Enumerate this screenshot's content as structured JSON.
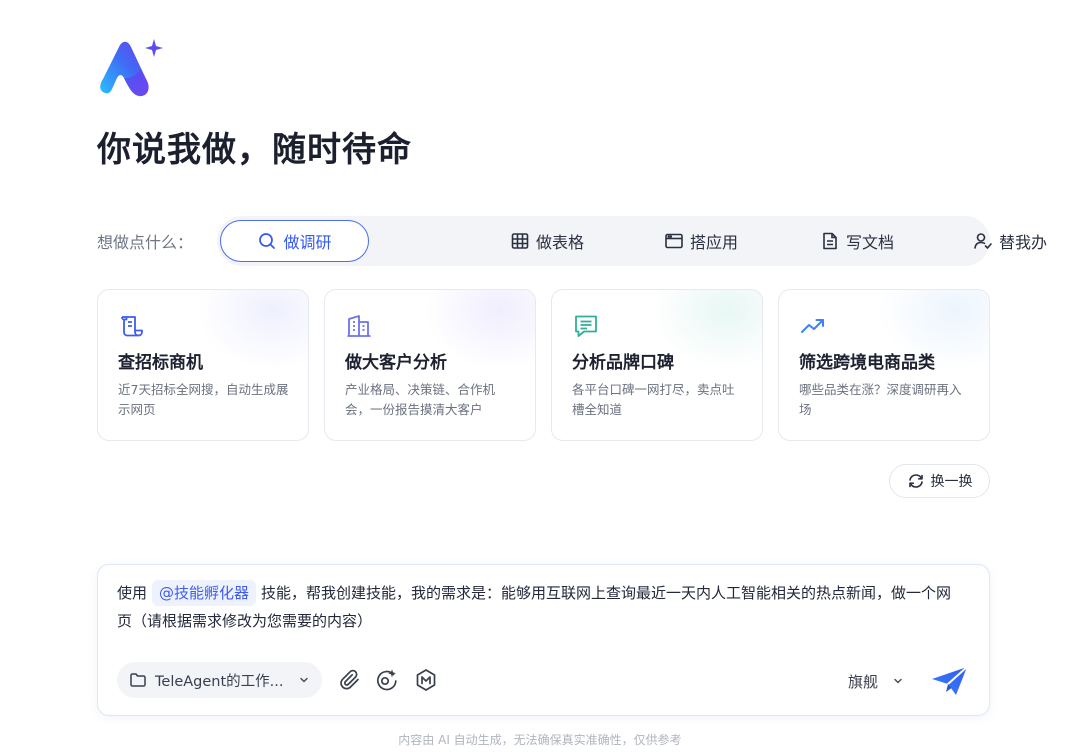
{
  "headline": "你说我做，随时待命",
  "prompt": {
    "label": "想做点什么：",
    "tabs": [
      {
        "label": "做调研",
        "icon": "search-icon",
        "active": true
      },
      {
        "label": "做表格",
        "icon": "table-icon",
        "active": false
      },
      {
        "label": "搭应用",
        "icon": "app-window-icon",
        "active": false
      },
      {
        "label": "写文档",
        "icon": "document-icon",
        "active": false
      },
      {
        "label": "替我办",
        "icon": "user-check-icon",
        "active": false
      }
    ]
  },
  "cards": [
    {
      "title": "查招标商机",
      "desc": "近7天招标全网搜，自动生成展示网页",
      "icon": "scroll-icon",
      "color": "#3d5cf0"
    },
    {
      "title": "做大客户分析",
      "desc": "产业格局、决策链、合作机会，一份报告摸清大客户",
      "icon": "building-icon",
      "color": "#6b72ef"
    },
    {
      "title": "分析品牌口碑",
      "desc": "各平台口碑一网打尽，卖点吐槽全知道",
      "icon": "comment-icon",
      "color": "#2fae9a"
    },
    {
      "title": "筛选跨境电商品类",
      "desc": "哪些品类在涨？深度调研再入场",
      "icon": "trending-up-icon",
      "color": "#3a82f6"
    }
  ],
  "shuffle_label": "换一换",
  "composer": {
    "text_prefix": "使用",
    "skill_chip": "@技能孵化器",
    "text_body": "技能，帮我创建技能，我的需求是：能够用互联网上查询最近一天内人工智能相关的热点新闻，做一个网页（请根据需求修改为您需要的内容）",
    "folder_label": "TeleAgent的工作...",
    "model_label": "旗舰"
  },
  "disclaimer": "内容由 AI 自动生成，无法确保真实准确性，仅供参考",
  "colors": {
    "accent": "#3d5cf0",
    "tab_bg": "#f3f4f7",
    "chip_bg": "#eef2ff"
  }
}
